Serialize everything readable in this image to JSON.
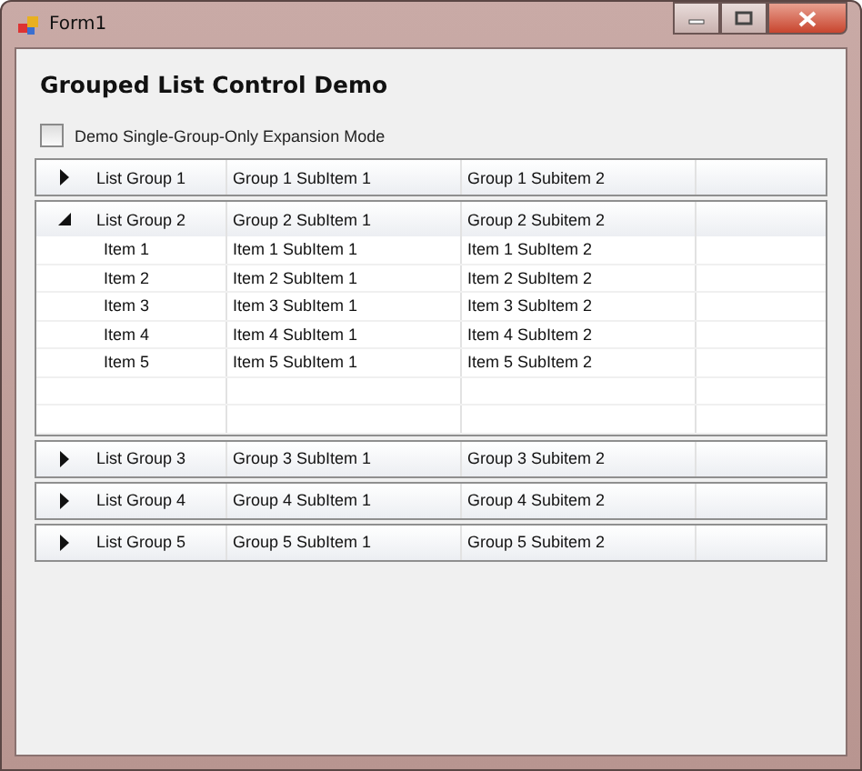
{
  "window": {
    "title": "Form1"
  },
  "heading": "Grouped List Control Demo",
  "checkbox": {
    "label": "Demo Single-Group-Only Expansion Mode",
    "checked": false
  },
  "groups": [
    {
      "cells": [
        "List Group 1",
        "Group 1 SubItem 1",
        "Group 1 Subitem 2"
      ],
      "expanded": false
    },
    {
      "cells": [
        "List Group 2",
        "Group 2 SubItem 1",
        "Group 2 Subitem 2"
      ],
      "expanded": true,
      "items": [
        {
          "cells": [
            "Item 1",
            "Item 1 SubItem 1",
            "Item 1 SubItem 2"
          ]
        },
        {
          "cells": [
            "Item 2",
            "Item 2 SubItem 1",
            "Item 2 SubItem 2"
          ]
        },
        {
          "cells": [
            "Item 3",
            "Item 3 SubItem 1",
            "Item 3 SubItem 2"
          ]
        },
        {
          "cells": [
            "Item 4",
            "Item 4 SubItem 1",
            "Item 4 SubItem 2"
          ]
        },
        {
          "cells": [
            "Item 5",
            "Item 5 SubItem 1",
            "Item 5 SubItem 2"
          ]
        }
      ]
    },
    {
      "cells": [
        "List Group 3",
        "Group 3 SubItem 1",
        "Group 3 Subitem 2"
      ],
      "expanded": false
    },
    {
      "cells": [
        "List Group 4",
        "Group 4 SubItem 1",
        "Group 4 Subitem 2"
      ],
      "expanded": false
    },
    {
      "cells": [
        "List Group 5",
        "Group 5 SubItem 1",
        "Group 5 Subitem 2"
      ],
      "expanded": false
    }
  ]
}
